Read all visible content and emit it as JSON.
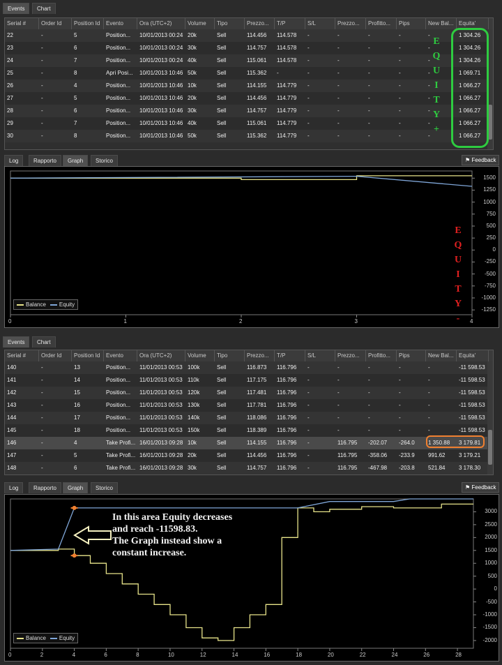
{
  "top_tabs": [
    "Events",
    "Chart"
  ],
  "columns": [
    "Serial #",
    "Order Id",
    "Position Id",
    "Evento",
    "Ora (UTC+2)",
    "Volume",
    "Tipo",
    "Prezzo...",
    "T/P",
    "S/L",
    "Prezzo...",
    "Profitto...",
    "Pips",
    "New Bal...",
    "Equita'"
  ],
  "table1_rows": [
    [
      "22",
      "-",
      "5",
      "Position...",
      "10/01/2013 00:24",
      "20k",
      "Sell",
      "114.456",
      "114.578",
      "-",
      "-",
      "-",
      "-",
      "-",
      "1 304.26"
    ],
    [
      "23",
      "-",
      "6",
      "Position...",
      "10/01/2013 00:24",
      "30k",
      "Sell",
      "114.757",
      "114.578",
      "-",
      "-",
      "-",
      "-",
      "-",
      "1 304.26"
    ],
    [
      "24",
      "-",
      "7",
      "Position...",
      "10/01/2013 00:24",
      "40k",
      "Sell",
      "115.061",
      "114.578",
      "-",
      "-",
      "-",
      "-",
      "-",
      "1 304.26"
    ],
    [
      "25",
      "-",
      "8",
      "Apri  Posi...",
      "10/01/2013 10:46",
      "50k",
      "Sell",
      "115.362",
      "-",
      "-",
      "-",
      "-",
      "-",
      "-",
      "1 069.71"
    ],
    [
      "26",
      "-",
      "4",
      "Position...",
      "10/01/2013 10:46",
      "10k",
      "Sell",
      "114.155",
      "114.779",
      "-",
      "-",
      "-",
      "-",
      "-",
      "1 066.27"
    ],
    [
      "27",
      "-",
      "5",
      "Position...",
      "10/01/2013 10:46",
      "20k",
      "Sell",
      "114.456",
      "114.779",
      "-",
      "-",
      "-",
      "-",
      "-",
      "1 066.27"
    ],
    [
      "28",
      "-",
      "6",
      "Position...",
      "10/01/2013 10:46",
      "30k",
      "Sell",
      "114.757",
      "114.779",
      "-",
      "-",
      "-",
      "-",
      "-",
      "1 066.27"
    ],
    [
      "29",
      "-",
      "7",
      "Position...",
      "10/01/2013 10:46",
      "40k",
      "Sell",
      "115.061",
      "114.779",
      "-",
      "-",
      "-",
      "-",
      "-",
      "1 066.27"
    ],
    [
      "30",
      "-",
      "8",
      "Position...",
      "10/01/2013 10:46",
      "50k",
      "Sell",
      "115.362",
      "114.779",
      "-",
      "-",
      "-",
      "-",
      "-",
      "1 066.27"
    ]
  ],
  "table2_rows": [
    [
      "140",
      "-",
      "13",
      "Position...",
      "11/01/2013 00:53",
      "100k",
      "Sell",
      "116.873",
      "116.796",
      "-",
      "-",
      "-",
      "-",
      "-",
      "-11 598.53"
    ],
    [
      "141",
      "-",
      "14",
      "Position...",
      "11/01/2013 00:53",
      "110k",
      "Sell",
      "117.175",
      "116.796",
      "-",
      "-",
      "-",
      "-",
      "-",
      "-11 598.53"
    ],
    [
      "142",
      "-",
      "15",
      "Position...",
      "11/01/2013 00:53",
      "120k",
      "Sell",
      "117.481",
      "116.796",
      "-",
      "-",
      "-",
      "-",
      "-",
      "-11 598.53"
    ],
    [
      "143",
      "-",
      "16",
      "Position...",
      "11/01/2013 00:53",
      "130k",
      "Sell",
      "117.781",
      "116.796",
      "-",
      "-",
      "-",
      "-",
      "-",
      "-11 598.53"
    ],
    [
      "144",
      "-",
      "17",
      "Position...",
      "11/01/2013 00:53",
      "140k",
      "Sell",
      "118.086",
      "116.796",
      "-",
      "-",
      "-",
      "-",
      "-",
      "-11 598.53"
    ],
    [
      "145",
      "-",
      "18",
      "Position...",
      "11/01/2013 00:53",
      "150k",
      "Sell",
      "118.389",
      "116.796",
      "-",
      "-",
      "-",
      "-",
      "-",
      "-11 598.53"
    ],
    [
      "146",
      "-",
      "4",
      "Take Profi...",
      "16/01/2013 09:28",
      "10k",
      "Sell",
      "114.155",
      "116.796",
      "-",
      "116.795",
      "-202.07",
      "-264.0",
      "1 350.88",
      "3 179.81"
    ],
    [
      "147",
      "-",
      "5",
      "Take Profi...",
      "16/01/2013 09:28",
      "20k",
      "Sell",
      "114.456",
      "116.796",
      "-",
      "116.795",
      "-358.06",
      "-233.9",
      "991.62",
      "3 179.21"
    ],
    [
      "148",
      "-",
      "6",
      "Take Profi...",
      "16/01/2013 09:28",
      "30k",
      "Sell",
      "114.757",
      "116.796",
      "-",
      "116.795",
      "-467.98",
      "-203.8",
      "521.84",
      "3 178.30"
    ]
  ],
  "sub_tabs": [
    "Log",
    "Rapporto",
    "Graph",
    "Storico"
  ],
  "feedback_label": "Feedback",
  "legend": {
    "balance": "Balance",
    "equity": "Equity"
  },
  "annotation1_letters": [
    "E",
    "Q",
    "U",
    "I",
    "T",
    "Y",
    "+"
  ],
  "annotation2_letters": [
    "E",
    "Q",
    "U",
    "I",
    "T",
    "Y",
    "-"
  ],
  "annotation3_lines": [
    "In this area Equity decreases",
    "and reach -11598.83.",
    "The Graph instead show a",
    "constant increase."
  ],
  "colors": {
    "balance": "#e8e48a",
    "equity": "#7fa6d8",
    "green_mark": "#2ecc40",
    "red_mark": "#e02020",
    "orange_mark": "#f08030"
  },
  "chart_data": [
    {
      "type": "line",
      "x_ticks": [
        "0",
        "1",
        "2",
        "3",
        "4"
      ],
      "y_ticks": [
        "1500",
        "1250",
        "1000",
        "750",
        "500",
        "250",
        "0",
        "-250",
        "-500",
        "-750",
        "-1000",
        "-1250"
      ],
      "xlim": [
        0,
        4
      ],
      "ylim": [
        -1350,
        1650
      ],
      "series": [
        {
          "name": "Balance",
          "points": [
            [
              0,
              1500
            ],
            [
              2,
              1500
            ],
            [
              2,
              1470
            ],
            [
              3,
              1470
            ],
            [
              3,
              1550
            ],
            [
              4,
              1550
            ]
          ]
        },
        {
          "name": "Equity",
          "points": [
            [
              0,
              1500
            ],
            [
              3,
              1540
            ],
            [
              4,
              1330
            ]
          ]
        }
      ]
    },
    {
      "type": "line",
      "x_ticks": [
        "0",
        "2",
        "4",
        "6",
        "8",
        "10",
        "12",
        "14",
        "16",
        "18",
        "20",
        "22",
        "24",
        "26",
        "28"
      ],
      "y_ticks": [
        "3000",
        "2500",
        "2000",
        "1500",
        "1000",
        "500",
        "0",
        "-500",
        "-1000",
        "-1500",
        "-2000"
      ],
      "xlim": [
        0,
        29
      ],
      "ylim": [
        -2300,
        3500
      ],
      "series": [
        {
          "name": "Balance",
          "points": [
            [
              0,
              1500
            ],
            [
              2,
              1500
            ],
            [
              3,
              1500
            ],
            [
              3,
              1550
            ],
            [
              4,
              1550
            ],
            [
              4,
              1300
            ],
            [
              5,
              1300
            ],
            [
              5,
              1000
            ],
            [
              6,
              1000
            ],
            [
              6,
              600
            ],
            [
              7,
              600
            ],
            [
              7,
              200
            ],
            [
              8,
              200
            ],
            [
              8,
              -200
            ],
            [
              9,
              -200
            ],
            [
              9,
              -600
            ],
            [
              10,
              -600
            ],
            [
              10,
              -1000
            ],
            [
              11,
              -1000
            ],
            [
              11,
              -1500
            ],
            [
              12,
              -1500
            ],
            [
              12,
              -1900
            ],
            [
              13,
              -1900
            ],
            [
              13,
              -2000
            ],
            [
              14,
              -2000
            ],
            [
              14,
              -1500
            ],
            [
              15,
              -1500
            ],
            [
              15,
              -1000
            ],
            [
              16,
              -1000
            ],
            [
              16,
              -600
            ],
            [
              17,
              -600
            ],
            [
              17,
              2000
            ],
            [
              18,
              2000
            ],
            [
              18,
              3150
            ],
            [
              19,
              3150
            ],
            [
              19,
              3000
            ],
            [
              20,
              3000
            ],
            [
              20,
              3100
            ],
            [
              22,
              3100
            ],
            [
              22,
              3200
            ],
            [
              24,
              3200
            ],
            [
              24,
              3150
            ],
            [
              27,
              3150
            ],
            [
              27,
              3300
            ],
            [
              29,
              3300
            ]
          ]
        },
        {
          "name": "Equity",
          "points": [
            [
              0,
              1500
            ],
            [
              3,
              1550
            ],
            [
              4,
              3150
            ],
            [
              18,
              3150
            ],
            [
              20,
              3400
            ],
            [
              24,
              3400
            ],
            [
              25,
              3500
            ],
            [
              29,
              3500
            ]
          ]
        }
      ]
    }
  ]
}
